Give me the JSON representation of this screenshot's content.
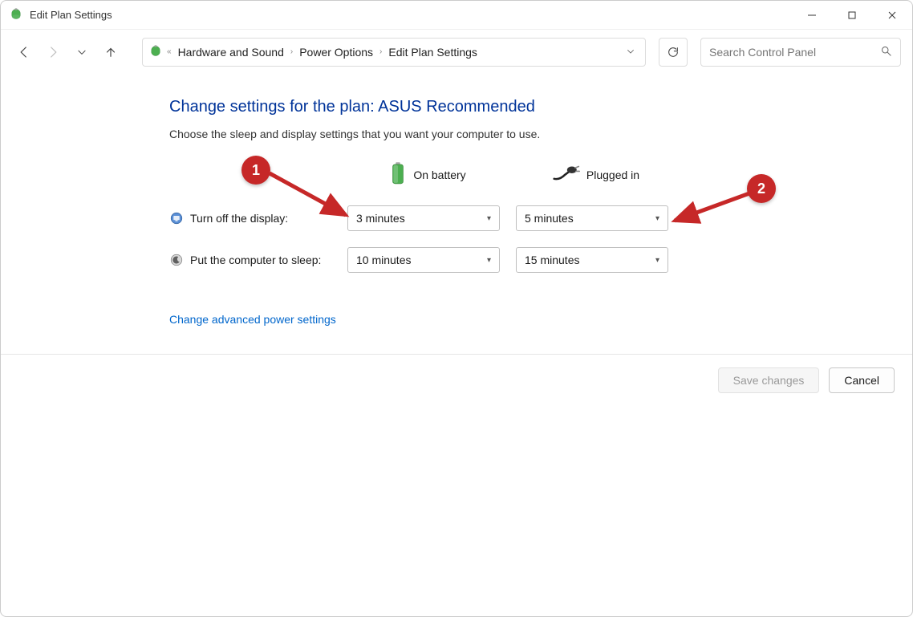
{
  "window": {
    "title": "Edit Plan Settings"
  },
  "breadcrumb": {
    "items": [
      "Hardware and Sound",
      "Power Options",
      "Edit Plan Settings"
    ]
  },
  "search": {
    "placeholder": "Search Control Panel"
  },
  "page": {
    "heading": "Change settings for the plan: ASUS Recommended",
    "subtext": "Choose the sleep and display settings that you want your computer to use.",
    "col_battery": "On battery",
    "col_plugged": "Plugged in",
    "rows": {
      "display": {
        "label": "Turn off the display:",
        "battery": "3 minutes",
        "plugged": "5 minutes"
      },
      "sleep": {
        "label": "Put the computer to sleep:",
        "battery": "10 minutes",
        "plugged": "15 minutes"
      }
    },
    "advanced_link": "Change advanced power settings"
  },
  "footer": {
    "save": "Save changes",
    "cancel": "Cancel"
  },
  "annotations": {
    "badge1": "1",
    "badge2": "2"
  }
}
